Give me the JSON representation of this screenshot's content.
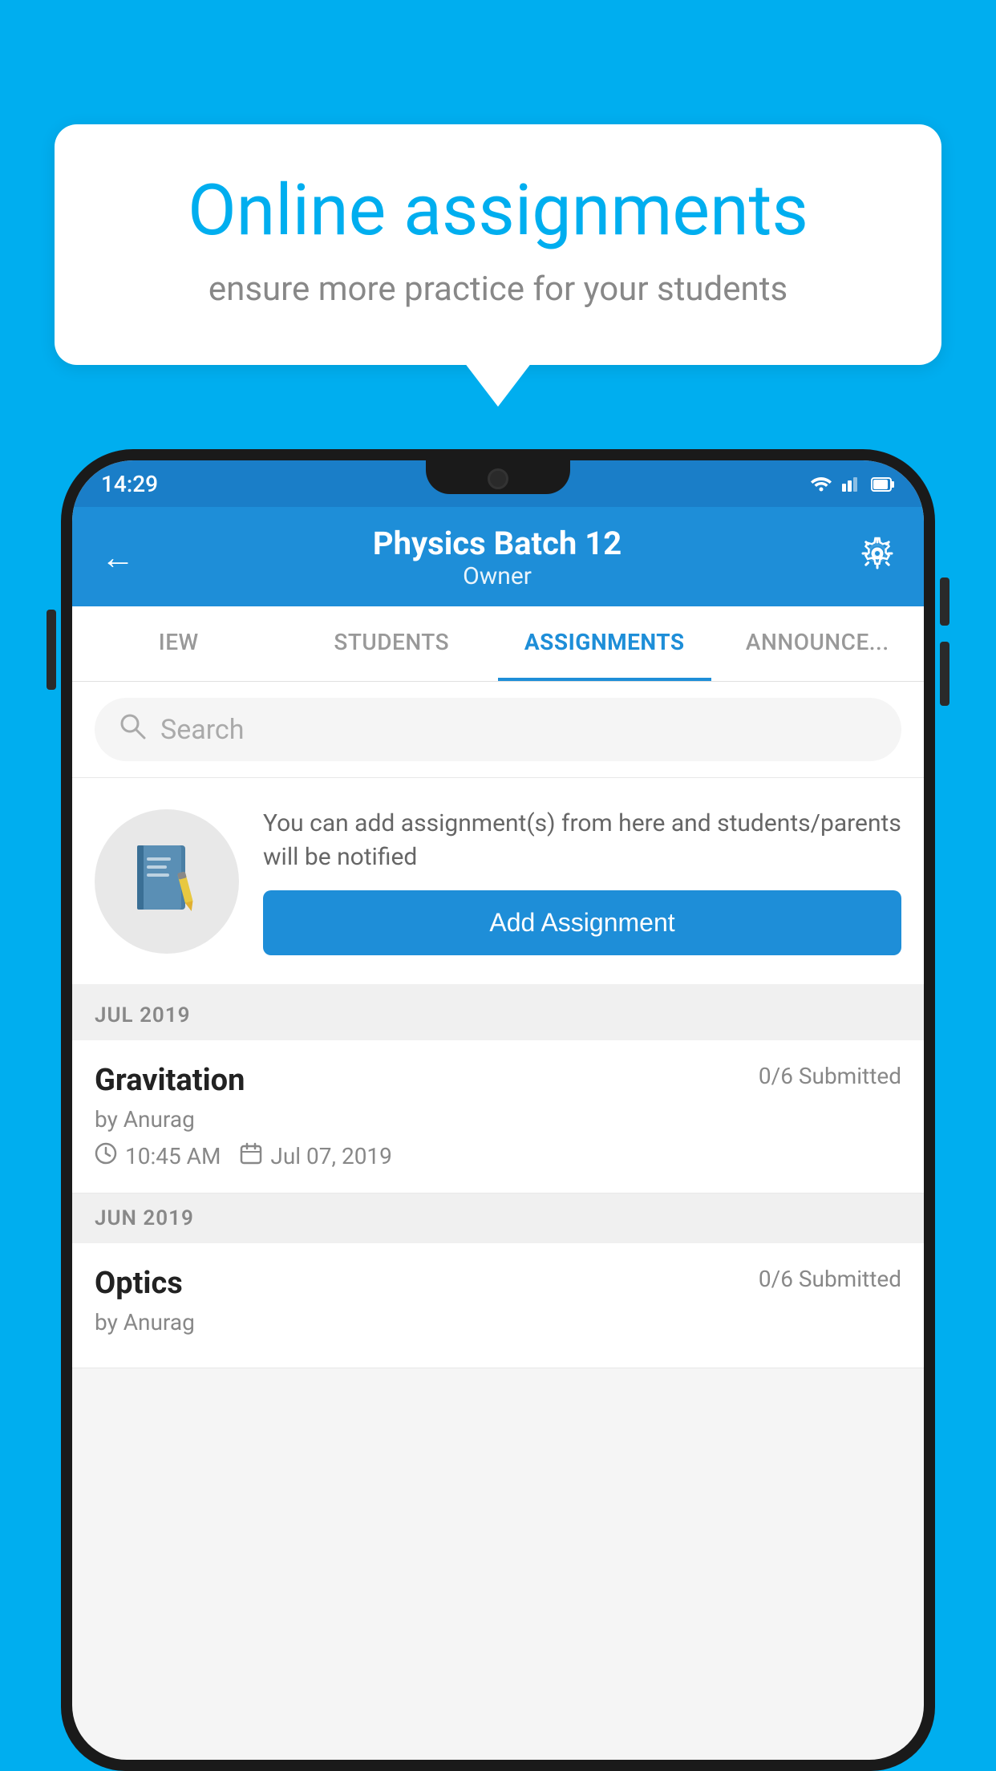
{
  "background_color": "#00AEEF",
  "speech_bubble": {
    "title": "Online assignments",
    "subtitle": "ensure more practice for your students"
  },
  "status_bar": {
    "time": "14:29",
    "wifi": "▲",
    "signal": "▲",
    "battery": "▮"
  },
  "header": {
    "title": "Physics Batch 12",
    "subtitle": "Owner",
    "back_label": "←",
    "settings_label": "⚙"
  },
  "tabs": [
    {
      "label": "IEW",
      "active": false
    },
    {
      "label": "STUDENTS",
      "active": false
    },
    {
      "label": "ASSIGNMENTS",
      "active": true
    },
    {
      "label": "ANNOUNCEMENTS",
      "active": false
    }
  ],
  "search": {
    "placeholder": "Search"
  },
  "promo": {
    "description": "You can add assignment(s) from here and students/parents will be notified",
    "button_label": "Add Assignment"
  },
  "sections": [
    {
      "month": "JUL 2019",
      "assignments": [
        {
          "title": "Gravitation",
          "submitted": "0/6 Submitted",
          "author": "by Anurag",
          "time": "10:45 AM",
          "date": "Jul 07, 2019"
        }
      ]
    },
    {
      "month": "JUN 2019",
      "assignments": [
        {
          "title": "Optics",
          "submitted": "0/6 Submitted",
          "author": "by Anurag",
          "time": "",
          "date": ""
        }
      ]
    }
  ]
}
